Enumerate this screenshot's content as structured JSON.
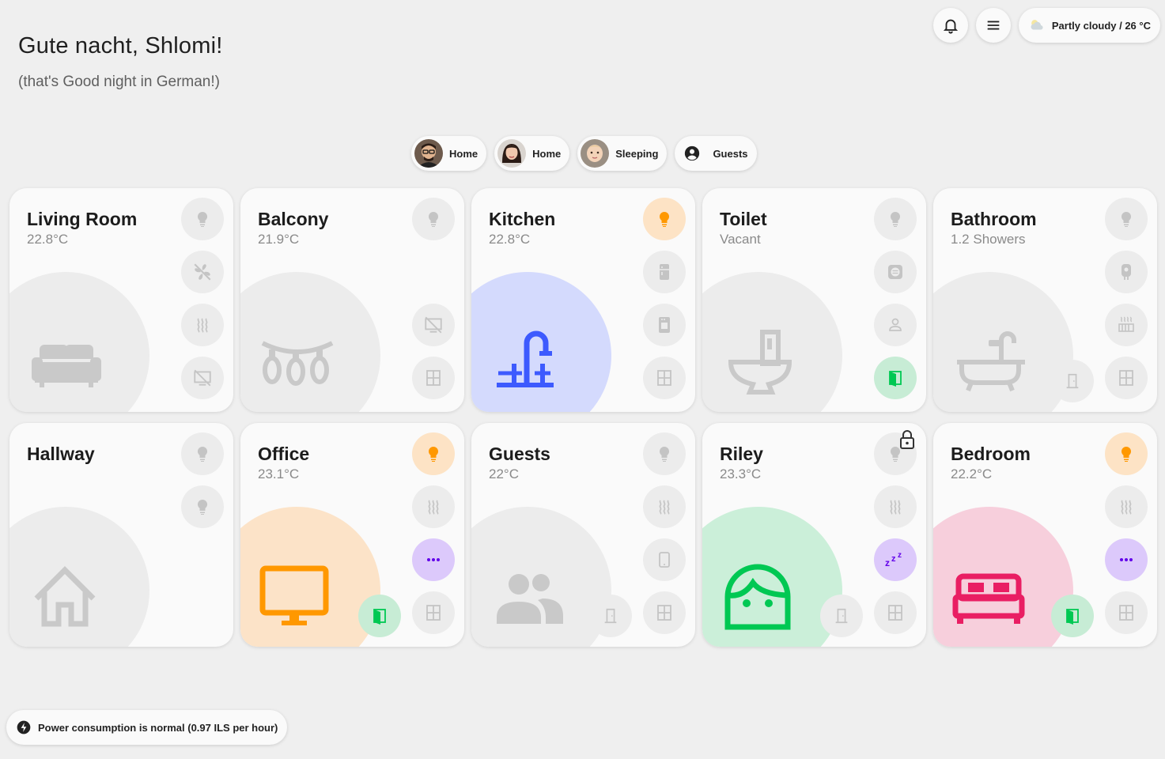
{
  "header": {
    "greeting": "Gute nacht, Shlomi!",
    "subtitle": "(that's Good night in German!)",
    "notifications_icon": "bell-icon",
    "menu_icon": "menu-icon",
    "weather": {
      "label": "Partly cloudy / 26 °C",
      "icon": "partly-cloudy-icon"
    }
  },
  "people": [
    {
      "label": "Home",
      "avatar": "man-glasses"
    },
    {
      "label": "Home",
      "avatar": "woman"
    },
    {
      "label": "Sleeping",
      "avatar": "child"
    },
    {
      "label": "Guests",
      "icon": "account-circle-icon"
    }
  ],
  "rooms": [
    {
      "name": "Living Room",
      "sub": "22.8°C",
      "icon": "sofa-icon",
      "controls": [
        "light-off",
        "fan-off",
        "heater-off",
        "tv-off"
      ]
    },
    {
      "name": "Balcony",
      "sub": "21.9°C",
      "icon": "string-lights-icon",
      "controls": [
        "light-off",
        "tv-off",
        "window-closed"
      ]
    },
    {
      "name": "Kitchen",
      "sub": "22.8°C",
      "icon": "faucet-icon",
      "controls": [
        "light-on",
        "fridge",
        "dishwasher",
        "window-closed"
      ]
    },
    {
      "name": "Toilet",
      "sub": "Vacant",
      "icon": "toilet-icon",
      "controls": [
        "light-off",
        "fan-off",
        "presence",
        "door-open"
      ]
    },
    {
      "name": "Bathroom",
      "sub": "1.2 Showers",
      "icon": "bathtub-icon",
      "controls": [
        "light-off",
        "boiler",
        "towel-heater",
        "window-closed"
      ]
    },
    {
      "name": "Hallway",
      "sub": "",
      "icon": "home-icon",
      "controls": [
        "light-off",
        "light-off"
      ]
    },
    {
      "name": "Office",
      "sub": "23.1°C",
      "icon": "monitor-icon",
      "controls": [
        "light-on",
        "heater-off",
        "more",
        "window-closed"
      ]
    },
    {
      "name": "Guests",
      "sub": "22°C",
      "icon": "guests-icon",
      "controls": [
        "light-off",
        "heater-off",
        "tablet",
        "window-closed"
      ]
    },
    {
      "name": "Riley",
      "sub": "23.3°C",
      "icon": "face-icon",
      "controls": [
        "light-off",
        "heater-off",
        "sleep",
        "window-closed"
      ]
    },
    {
      "name": "Bedroom",
      "sub": "22.2°C",
      "icon": "bed-icon",
      "controls": [
        "light-on",
        "heater-off",
        "more",
        "window-closed"
      ]
    }
  ],
  "footer": {
    "power_status": "Power consumption is normal (0.97 ILS per hour)"
  },
  "colors": {
    "background": "#efefef",
    "card": "#fafafa",
    "light_on": "#ff9800",
    "light_on_bg": "#fde3c5",
    "kitchen_blue": "#3d5afe",
    "kitchen_blob": "#d4dafd",
    "office_orange": "#ff9800",
    "office_blob": "#fce3c8",
    "riley_green": "#00c853",
    "riley_blob": "#cbefd9",
    "bedroom_pink": "#e91e63",
    "bedroom_blob": "#f7cfdc",
    "purple_accent": "#6200ea",
    "inactive_icon": "#c4c4c4"
  }
}
